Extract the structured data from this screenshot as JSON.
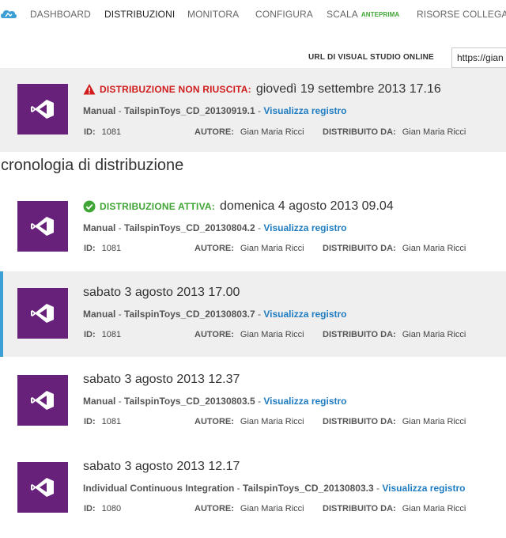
{
  "nav": {
    "items": [
      {
        "label": "DASHBOARD"
      },
      {
        "label": "DISTRIBUZIONI"
      },
      {
        "label": "MONITORA"
      },
      {
        "label": "CONFIGURA"
      },
      {
        "label": "SCALA",
        "badge": "ANTEPRIMA"
      },
      {
        "label": "RISORSE COLLEGATE"
      }
    ],
    "active_index": 1
  },
  "url_field": {
    "label": "URL DI VISUAL STUDIO ONLINE",
    "value": "https://gian"
  },
  "history_title": "cronologia di distribuzione",
  "colors": {
    "tile": "#68217a",
    "link": "#1f7cc1",
    "fail": "#d01c1c",
    "success": "#3fa535",
    "selected_bar": "#3c9fd6"
  },
  "failed_deployment": {
    "status": "DISTRIBUZIONE NON RIUSCITA:",
    "status_icon": "warning-icon",
    "date": "giovedì 19 settembre 2013 17.16",
    "source": "Manual",
    "package": "TailspinToys_CD_20130919.1",
    "link": "Visualizza registro",
    "id_label": "ID:",
    "id": "1081",
    "author_label": "AUTORE:",
    "author": "Gian Maria Ricci",
    "deployer_label": "DISTRIBUITO DA:",
    "deployer": "Gian Maria Ricci"
  },
  "history": [
    {
      "status": "DISTRIBUZIONE ATTIVA:",
      "status_icon": "check-circle-icon",
      "date": "domenica 4 agosto 2013 09.04",
      "source": "Manual",
      "package": "TailspinToys_CD_20130804.2",
      "link": "Visualizza registro",
      "id_label": "ID:",
      "id": "1081",
      "author_label": "AUTORE:",
      "author": "Gian Maria Ricci",
      "deployer_label": "DISTRIBUITO DA:",
      "deployer": "Gian Maria Ricci"
    },
    {
      "date": "sabato 3 agosto 2013 17.00",
      "source": "Manual",
      "package": "TailspinToys_CD_20130803.7",
      "link": "Visualizza registro",
      "id_label": "ID:",
      "id": "1081",
      "author_label": "AUTORE:",
      "author": "Gian Maria Ricci",
      "deployer_label": "DISTRIBUITO DA:",
      "deployer": "Gian Maria Ricci"
    },
    {
      "date": "sabato 3 agosto 2013 12.37",
      "source": "Manual",
      "package": "TailspinToys_CD_20130803.5",
      "link": "Visualizza registro",
      "id_label": "ID:",
      "id": "1081",
      "author_label": "AUTORE:",
      "author": "Gian Maria Ricci",
      "deployer_label": "DISTRIBUITO DA:",
      "deployer": "Gian Maria Ricci"
    },
    {
      "date": "sabato 3 agosto 2013 12.17",
      "source": "Individual Continuous Integration",
      "package": "TailspinToys_CD_20130803.3",
      "link": "Visualizza registro",
      "id_label": "ID:",
      "id": "1080",
      "author_label": "AUTORE:",
      "author": "Gian Maria Ricci",
      "deployer_label": "DISTRIBUITO DA:",
      "deployer": "Gian Maria Ricci"
    }
  ]
}
